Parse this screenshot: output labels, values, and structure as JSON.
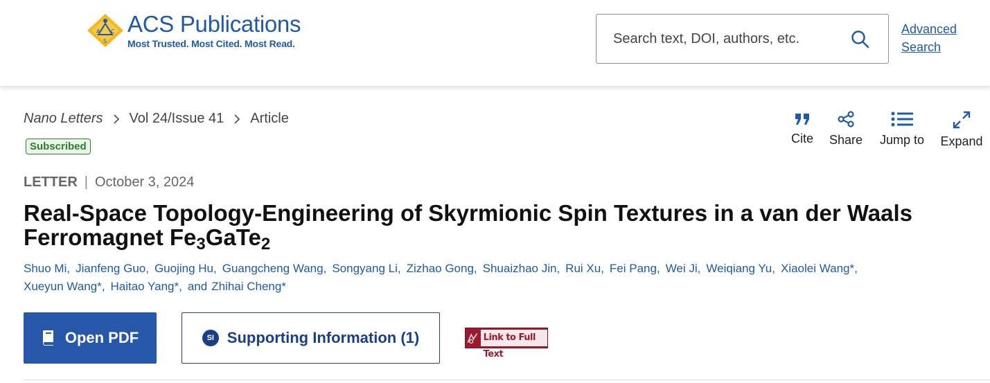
{
  "header": {
    "logo_title": "ACS Publications",
    "logo_tagline": "Most Trusted. Most Cited. Most Read.",
    "search_placeholder": "Search text, DOI, authors, etc.",
    "advanced_search": "Advanced Search"
  },
  "breadcrumb": {
    "journal": "Nano Letters",
    "issue": "Vol 24/Issue 41",
    "page": "Article"
  },
  "badge": "Subscribed",
  "toolbar": {
    "cite": "Cite",
    "share": "Share",
    "jump": "Jump to",
    "expand": "Expand"
  },
  "article": {
    "type": "LETTER",
    "date": "October 3, 2024",
    "title_part1": "Real-Space Topology-Engineering of Skyrmionic Spin Textures in a van der Waals Ferromagnet Fe",
    "title_sub1": "3",
    "title_part2": "GaTe",
    "title_sub2": "2",
    "authors_line1": [
      "Shuo Mi,",
      "Jianfeng Guo,",
      "Guojing Hu,",
      "Guangcheng Wang,",
      "Songyang Li,",
      "Zizhao Gong,",
      "Shuaizhao Jin,",
      "Rui Xu,",
      "Fei Pang,",
      "Wei Ji,",
      "Weiqiang Yu,",
      "Xiaolei Wang*,"
    ],
    "authors_line2": [
      "Xueyun Wang*,",
      "Haitao Yang*,"
    ],
    "and": "and",
    "last_author": "Zhihai Cheng*"
  },
  "actions": {
    "open_pdf": "Open PDF",
    "si_badge": "SI",
    "supporting_info": "Supporting Information (1)",
    "full_text_link": "Link to Full Text"
  },
  "colors": {
    "brand_blue": "#1f5aa6",
    "pdf_button": "#2757a8",
    "subscribed_green": "#2e7d32",
    "full_text_red": "#9b1b2e"
  }
}
